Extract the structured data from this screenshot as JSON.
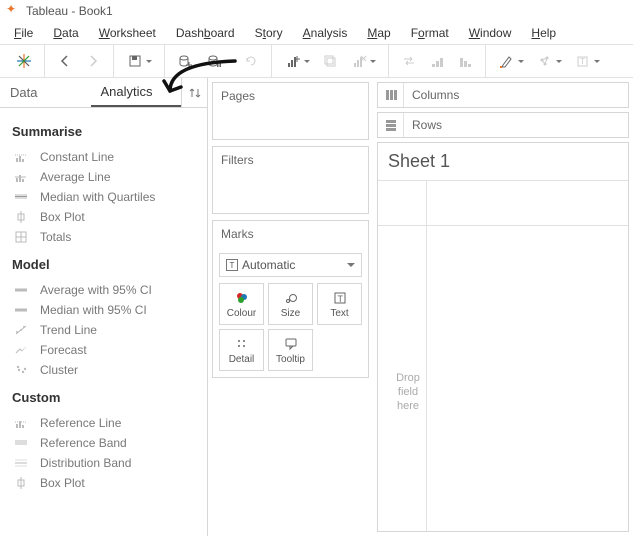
{
  "window": {
    "title": "Tableau - Book1"
  },
  "menu": [
    "File",
    "Data",
    "Worksheet",
    "Dashboard",
    "Story",
    "Analysis",
    "Map",
    "Format",
    "Window",
    "Help"
  ],
  "menu_accel": [
    "F",
    "D",
    "W",
    "b",
    "t",
    "A",
    "M",
    "o",
    "W",
    "H"
  ],
  "side_tabs": {
    "data": "Data",
    "analytics": "Analytics"
  },
  "analytics": {
    "summarise": {
      "header": "Summarise",
      "items": [
        "Constant Line",
        "Average Line",
        "Median with Quartiles",
        "Box Plot",
        "Totals"
      ]
    },
    "model": {
      "header": "Model",
      "items": [
        "Average with 95% CI",
        "Median with 95% CI",
        "Trend Line",
        "Forecast",
        "Cluster"
      ]
    },
    "custom": {
      "header": "Custom",
      "items": [
        "Reference Line",
        "Reference Band",
        "Distribution Band",
        "Box Plot"
      ]
    }
  },
  "cards": {
    "pages": "Pages",
    "filters": "Filters",
    "marks": "Marks"
  },
  "marks": {
    "dropdown": "Automatic",
    "buttons": [
      "Colour",
      "Size",
      "Text",
      "Detail",
      "Tooltip"
    ]
  },
  "shelves": {
    "columns": "Columns",
    "rows": "Rows"
  },
  "sheet": {
    "title": "Sheet 1",
    "drop_hint": "Drop field here"
  }
}
